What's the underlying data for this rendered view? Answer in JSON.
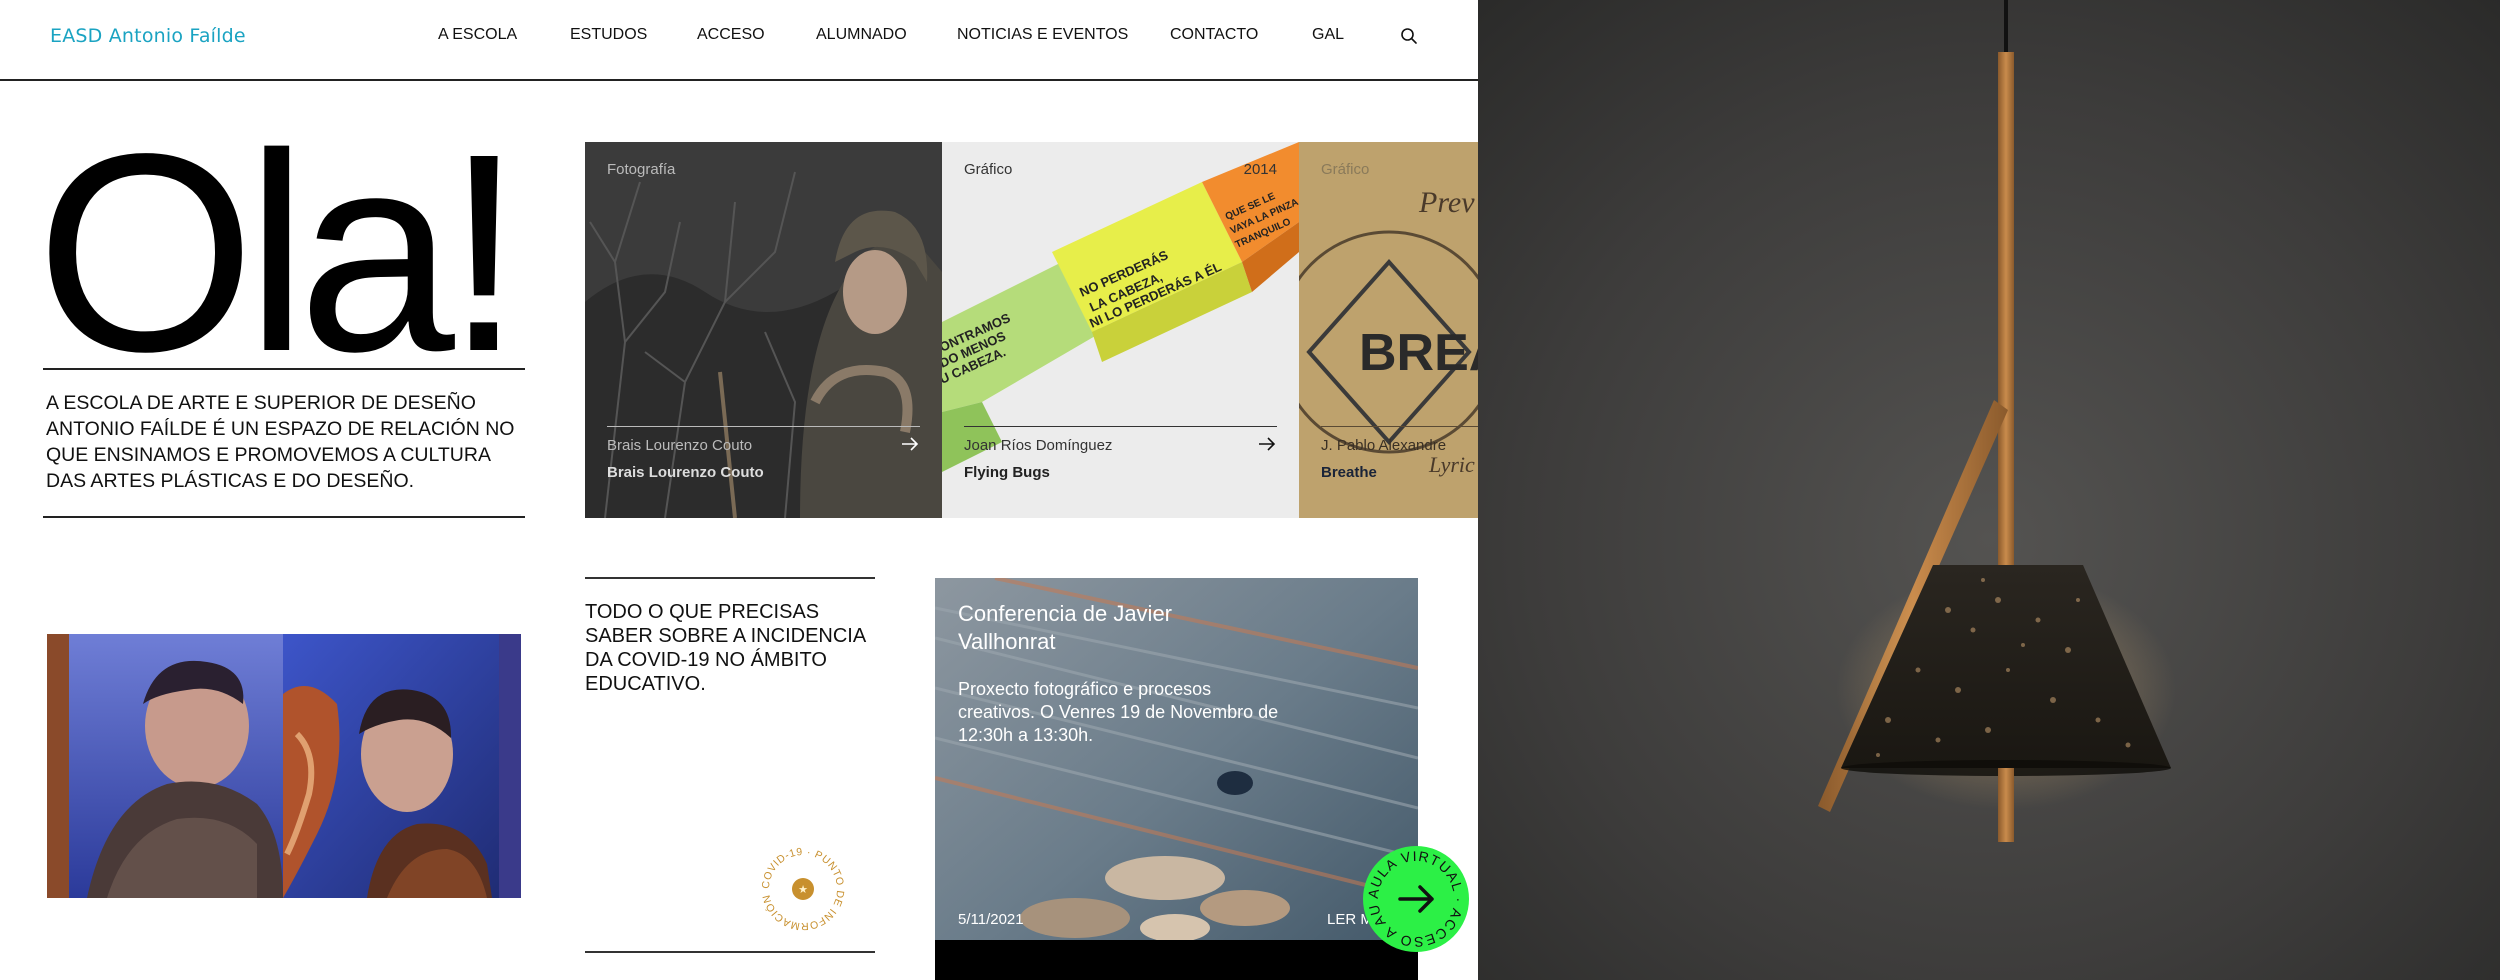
{
  "header": {
    "logo": "EASD Antonio Faílde",
    "nav": [
      {
        "label": "A ESCOLA"
      },
      {
        "label": "ESTUDOS"
      },
      {
        "label": "ACCESO"
      },
      {
        "label": "ALUMNADO"
      },
      {
        "label": "NOTICIAS E EVENTOS"
      },
      {
        "label": "CONTACTO"
      },
      {
        "label": "GAL"
      }
    ],
    "search_icon": "search-icon"
  },
  "hero": {
    "title": "Ola!",
    "intro": "A ESCOLA DE ARTE E SUPERIOR DE DESEÑO ANTONIO FAÍLDE É UN ESPAZO DE RELACIÓN NO QUE ENSINAMOS E PROMOVEMOS A CULTURA DAS ARTES PLÁSTICAS E DO DESEÑO."
  },
  "projects": [
    {
      "category": "Fotografía",
      "year": "",
      "author": "Brais Lourenzo Couto",
      "title": "Brais Lourenzo Couto"
    },
    {
      "category": "Gráfico",
      "year": "2014",
      "author": "Joan Ríos Domínguez",
      "title": "Flying Bugs"
    },
    {
      "category": "Gráfico",
      "year": "",
      "author": "J. Pablo Alexandre",
      "title": "Breathe"
    }
  ],
  "covid": {
    "text": "TODO O QUE PRECISAS SABER SOBRE A INCIDENCIA DA COVID-19 NO ÁMBITO EDUCATIVO.",
    "badge_text": "COVID-19 · PUNTO DE INFORMACIÓN ·"
  },
  "event": {
    "title": "Conferencia de Javier Vallhonrat",
    "description": "Proxecto fotográfico e procesos creativos. O Venres 19 de Novembro de 12:30h a 13:30h.",
    "date": "5/11/2021",
    "more": "LER MÁIS"
  },
  "aula_virtual": {
    "badge_text": "AULA VIRTUAL · ACCESO A AULA VIRTUAL ·"
  },
  "colors": {
    "logo": "#1aa3c2",
    "aula_badge": "#2cf046",
    "covid_badge": "#c8902e"
  }
}
